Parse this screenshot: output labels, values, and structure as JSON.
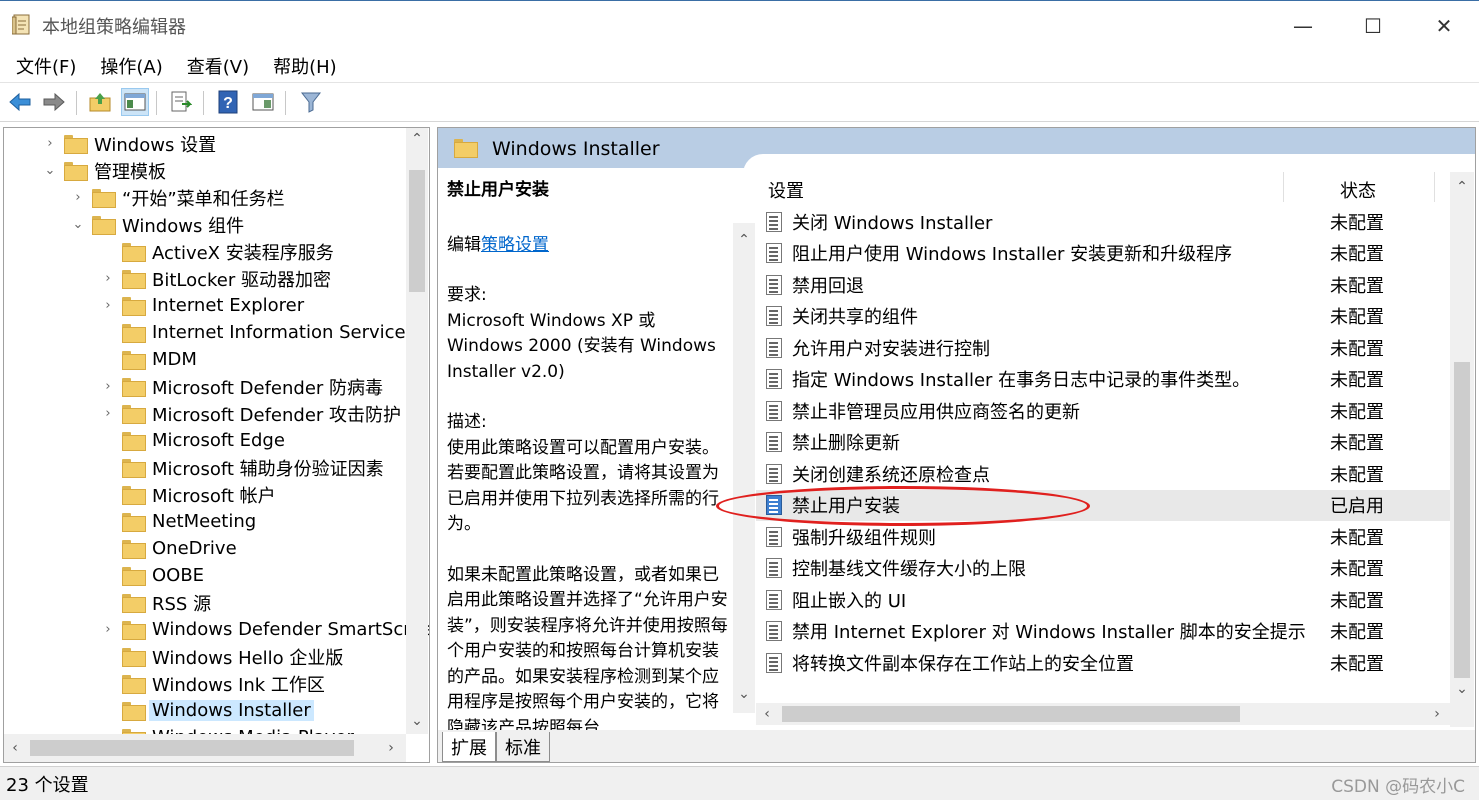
{
  "window": {
    "title": "本地组策略编辑器",
    "minimize_glyph": "—",
    "maximize_glyph": "☐",
    "close_glyph": "✕"
  },
  "menu": [
    "文件(F)",
    "操作(A)",
    "查看(V)",
    "帮助(H)"
  ],
  "toolbar": {
    "icons": [
      "back-icon",
      "forward-icon",
      "up-folder-icon",
      "show-hide-tree-icon",
      "export-list-icon",
      "help-icon",
      "properties-icon",
      "filter-icon"
    ]
  },
  "tree": {
    "items": [
      {
        "label": "Windows 设置",
        "expander": "›"
      },
      {
        "label": "管理模板",
        "expander": "⌄"
      },
      {
        "label": "“开始”菜单和任务栏",
        "expander": "›"
      },
      {
        "label": "Windows 组件",
        "expander": "⌄"
      },
      {
        "label": "ActiveX 安装程序服务",
        "expander": ""
      },
      {
        "label": "BitLocker 驱动器加密",
        "expander": "›"
      },
      {
        "label": "Internet Explorer",
        "expander": "›"
      },
      {
        "label": "Internet Information Services",
        "expander": ""
      },
      {
        "label": "MDM",
        "expander": ""
      },
      {
        "label": "Microsoft Defender 防病毒",
        "expander": "›"
      },
      {
        "label": "Microsoft Defender 攻击防护",
        "expander": "›"
      },
      {
        "label": "Microsoft Edge",
        "expander": ""
      },
      {
        "label": "Microsoft 辅助身份验证因素",
        "expander": ""
      },
      {
        "label": "Microsoft 帐户",
        "expander": ""
      },
      {
        "label": "NetMeeting",
        "expander": ""
      },
      {
        "label": "OneDrive",
        "expander": ""
      },
      {
        "label": "OOBE",
        "expander": ""
      },
      {
        "label": "RSS 源",
        "expander": ""
      },
      {
        "label": "Windows Defender SmartScreen",
        "expander": "›"
      },
      {
        "label": "Windows Hello 企业版",
        "expander": ""
      },
      {
        "label": "Windows Ink 工作区",
        "expander": ""
      },
      {
        "label": "Windows Installer",
        "expander": "",
        "selected": true
      },
      {
        "label": "Windows Media Player",
        "expander": ""
      }
    ]
  },
  "right_pane": {
    "header_title": "Windows Installer",
    "description": {
      "heading": "禁止用户安装",
      "edit_prefix": "编辑",
      "edit_link": "策略设置",
      "requirements_label": "要求:",
      "requirements_text": "Microsoft Windows XP 或 Windows 2000 (安装有 Windows Installer v2.0)",
      "description_label": "描述:",
      "description_p1": "使用此策略设置可以配置用户安装。若要配置此策略设置，请将其设置为已启用并使用下拉列表选择所需的行为。",
      "description_p2": "如果未配置此策略设置，或者如果已启用此策略设置并选择了“允许用户安装”，则安装程序将允许并使用按照每个用户安装的和按照每台计算机安装的产品。如果安装程序检测到某个应用程序是按照每个用户安装的，它将隐藏该产品按照每台"
    },
    "columns": {
      "setting": "设置",
      "status": "状态"
    },
    "settings": [
      {
        "name": "关闭 Windows Installer",
        "status": "未配置"
      },
      {
        "name": "阻止用户使用 Windows Installer 安装更新和升级程序",
        "status": "未配置"
      },
      {
        "name": "禁用回退",
        "status": "未配置"
      },
      {
        "name": "关闭共享的组件",
        "status": "未配置"
      },
      {
        "name": "允许用户对安装进行控制",
        "status": "未配置"
      },
      {
        "name": "指定 Windows Installer 在事务日志中记录的事件类型。",
        "status": "未配置"
      },
      {
        "name": "禁止非管理员应用供应商签名的更新",
        "status": "未配置"
      },
      {
        "name": "禁止删除更新",
        "status": "未配置"
      },
      {
        "name": "关闭创建系统还原检查点",
        "status": "未配置"
      },
      {
        "name": "禁止用户安装",
        "status": "已启用",
        "selected": true
      },
      {
        "name": "强制升级组件规则",
        "status": "未配置"
      },
      {
        "name": "控制基线文件缓存大小的上限",
        "status": "未配置"
      },
      {
        "name": "阻止嵌入的 UI",
        "status": "未配置"
      },
      {
        "name": "禁用 Internet Explorer 对 Windows Installer 脚本的安全提示",
        "status": "未配置"
      },
      {
        "name": "将转换文件副本保存在工作站上的安全位置",
        "status": "未配置"
      }
    ],
    "tabs": [
      "扩展",
      "标准"
    ]
  },
  "status_bar": {
    "count": "23 个设置",
    "watermark": "CSDN @码农小C"
  },
  "colors": {
    "header_bg": "#b9cde4",
    "selected_tree_bg": "#cce8ff",
    "selected_row_bg": "#e8e8e8",
    "annotation_ellipse": "#e0201e",
    "link": "#0066cc"
  }
}
